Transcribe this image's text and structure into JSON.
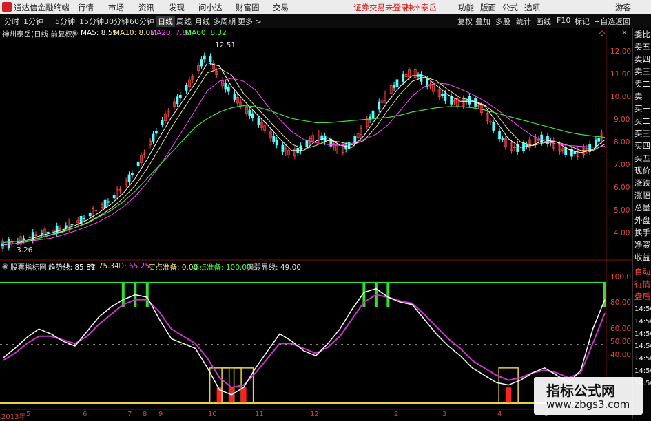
{
  "menu": {
    "app_title": "通达信金融终端",
    "items": [
      "行情",
      "市场",
      "资讯",
      "发现",
      "问小达",
      "财富圈",
      "交易"
    ],
    "status_text": "证券交易未登录",
    "stock_tag": "神州泰岳",
    "right_items": [
      "功能",
      "版面",
      "公式",
      "选项"
    ],
    "broker": "游客"
  },
  "toolbar": {
    "periods": [
      "分时",
      "1分钟",
      "5分钟",
      "15分钟",
      "30分钟",
      "60分钟",
      "日线",
      "周线",
      "月线",
      "多周期",
      "更多 >"
    ],
    "active_period": "日线",
    "right_buttons": [
      "复权",
      "叠加",
      "多股",
      "统计",
      "画线",
      "F10",
      "标记",
      "+自选",
      "返回"
    ]
  },
  "main_chart": {
    "title": "神州泰岳(日线 前复权)",
    "ma5": "MA5: 8.59",
    "ma10": "MA10: 8.05",
    "ma20": "MA20: 7.83",
    "ma60": "MA60: 8.32",
    "high_label": "12.51",
    "low_label": "3.26",
    "y_ticks": [
      "12.00",
      "11.00",
      "10.00",
      "9.00",
      "8.00",
      "7.00",
      "6.00",
      "5.00",
      "4.00"
    ]
  },
  "indicator": {
    "name": "股票指标网",
    "trend": "趋势线: 85.81",
    "k": "K: 75.34",
    "d": "D: 65.25",
    "buy_ready": "买点准备: 0.00",
    "sell_ready": "卖点准备: 100.00",
    "strong_weak": "强弱界线: 49.00",
    "y_ticks": [
      "100.0",
      "80.00",
      "60.00",
      "50.00",
      "40.00"
    ]
  },
  "xaxis": {
    "labels": [
      "2013年",
      "5",
      "6",
      "7",
      "8",
      "9",
      "10",
      "11",
      "12",
      "2",
      "3",
      "4",
      "5"
    ]
  },
  "right_panel": {
    "items": [
      "委比",
      "卖五",
      "卖四",
      "卖三",
      "卖二",
      "卖一",
      "买一",
      "买二",
      "买三",
      "买四",
      "买五",
      "现价",
      "涨跌",
      "涨幅",
      "总量",
      "外盘",
      "换手",
      "净资",
      "收益"
    ],
    "items2": [
      "自动",
      "行情",
      "盘后",
      "14:50",
      "14:50",
      "14:50",
      "14:50",
      "14:50",
      "14:50",
      "14:50"
    ]
  },
  "watermark": {
    "line1": "指标公式网",
    "line2": "www.zbgs3.com"
  },
  "chart_data": {
    "type": "line",
    "title": "神州泰岳(日线 前复权)",
    "price_close": [
      3.3,
      3.4,
      3.6,
      3.8,
      3.9,
      4.1,
      4.3,
      4.6,
      5.0,
      5.4,
      6.0,
      6.8,
      7.8,
      8.8,
      9.7,
      10.4,
      11.3,
      12.3,
      11.0,
      10.4,
      9.7,
      9.2,
      8.6,
      7.9,
      7.5,
      7.9,
      8.4,
      8.2,
      7.7,
      8.0,
      8.8,
      9.6,
      10.4,
      11.0,
      11.4,
      11.0,
      10.5,
      10.1,
      9.9,
      10.1,
      9.5,
      8.6,
      7.9,
      7.8,
      8.1,
      8.3,
      7.9,
      7.6,
      7.6,
      7.9,
      8.5
    ],
    "ma60": [
      3.4,
      3.45,
      3.5,
      3.6,
      3.75,
      3.9,
      4.1,
      4.3,
      4.6,
      4.9,
      5.3,
      5.8,
      6.4,
      7.0,
      7.6,
      8.2,
      8.8,
      9.2,
      9.5,
      9.7,
      9.8,
      9.75,
      9.6,
      9.4,
      9.2,
      9.1,
      9.0,
      9.0,
      9.05,
      9.1,
      9.15,
      9.2,
      9.25,
      9.35,
      9.5,
      9.6,
      9.7,
      9.75,
      9.75,
      9.7,
      9.6,
      9.45,
      9.3,
      9.15,
      9.0,
      8.85,
      8.7,
      8.55,
      8.45,
      8.38,
      8.32
    ],
    "ylim": [
      3.0,
      13.0
    ],
    "indicator_k": [
      38,
      46,
      55,
      62,
      58,
      52,
      48,
      60,
      72,
      80,
      86,
      90,
      88,
      70,
      54,
      50,
      46,
      30,
      12,
      8,
      14,
      30,
      44,
      58,
      52,
      44,
      40,
      50,
      62,
      78,
      92,
      95,
      88,
      84,
      82,
      70,
      58,
      48,
      40,
      30,
      24,
      18,
      16,
      20,
      26,
      30,
      24,
      18,
      28,
      62,
      86
    ],
    "indicator_d": [
      36,
      42,
      50,
      56,
      56,
      53,
      50,
      56,
      66,
      74,
      82,
      86,
      86,
      76,
      62,
      56,
      50,
      38,
      22,
      14,
      16,
      26,
      38,
      50,
      50,
      46,
      42,
      47,
      56,
      70,
      84,
      90,
      88,
      85,
      83,
      74,
      64,
      54,
      46,
      36,
      30,
      24,
      20,
      22,
      26,
      28,
      26,
      22,
      26,
      50,
      75
    ],
    "indicator_ylim": [
      0,
      105
    ]
  }
}
